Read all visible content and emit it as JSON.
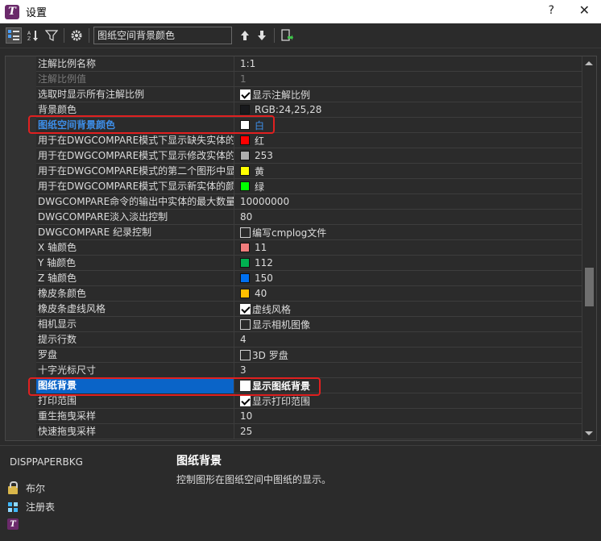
{
  "window": {
    "title": "设置",
    "help": "?",
    "close": "✕"
  },
  "toolbar": {
    "search_value": "图纸空间背景颜色"
  },
  "rows": [
    {
      "name": "注解比例名称",
      "value": "1:1"
    },
    {
      "name": "注解比例值",
      "value": "1"
    },
    {
      "name": "选取时显示所有注解比例",
      "value": "显示注解比例"
    },
    {
      "name": "背景颜色",
      "value": "RGB:24,25,28"
    },
    {
      "name": "图纸空间背景颜色",
      "value": "白"
    },
    {
      "name": "用于在DWGCOMPARE模式下显示缺失实体的",
      "value": "红"
    },
    {
      "name": "用于在DWGCOMPARE模式下显示修改实体的",
      "value": "253"
    },
    {
      "name": "用于在DWGCOMPARE模式的第二个图形中显示",
      "value": "黄"
    },
    {
      "name": "用于在DWGCOMPARE模式下显示新实体的颜色",
      "value": "绿"
    },
    {
      "name": "DWGCOMPARE命令的输出中实体的最大数量",
      "value": "10000000"
    },
    {
      "name": "DWGCOMPARE淡入淡出控制",
      "value": "80"
    },
    {
      "name": "DWGCOMPARE 纪录控制",
      "value": "编写cmplog文件"
    },
    {
      "name": "X 轴颜色",
      "value": "11"
    },
    {
      "name": "Y 轴颜色",
      "value": "112"
    },
    {
      "name": "Z 轴颜色",
      "value": "150"
    },
    {
      "name": "橡皮条颜色",
      "value": "40"
    },
    {
      "name": "橡皮条虚线风格",
      "value": "虚线风格"
    },
    {
      "name": "相机显示",
      "value": "显示相机图像"
    },
    {
      "name": "提示行数",
      "value": "4"
    },
    {
      "name": "罗盘",
      "value": "3D 罗盘"
    },
    {
      "name": "十字光标尺寸",
      "value": "3"
    },
    {
      "name": "图纸背景",
      "value": "显示图纸背景"
    },
    {
      "name": "打印范围",
      "value": "显示打印范围"
    },
    {
      "name": "重生拖曳采样",
      "value": "10"
    },
    {
      "name": "快速拖曳采样",
      "value": "25"
    }
  ],
  "colors": {
    "background_color": "#18191c",
    "white": "#ffffff",
    "red": "#ff0000",
    "color_253": "#adadad",
    "yellow": "#ffff00",
    "green": "#00ff00",
    "x_axis": "#f07c7c",
    "y_axis": "#00b050",
    "z_axis": "#0070f0",
    "rubberband": "#ffbf00",
    "selection": "#0a64c8",
    "callout": "#e02020"
  },
  "details": {
    "variable_name": "DISPPAPERBKG",
    "title": "图纸背景",
    "description": "控制图形在图纸空间中图纸的显示。",
    "legend_boolean": "布尔",
    "legend_registry": "注册表"
  }
}
